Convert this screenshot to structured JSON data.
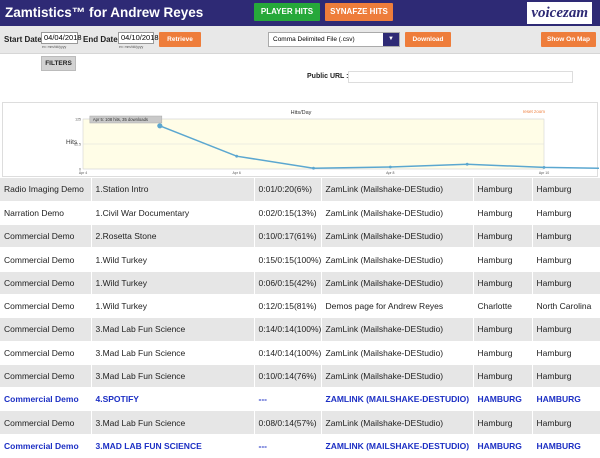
{
  "header": {
    "title": "Zamtistics™ for Andrew Reyes",
    "player_hits_label": "PLAYER HITS",
    "synafze_hits_label": "SYNAFZE HITS",
    "logo_text": "voicezam",
    "bg_color": "#2e2a75"
  },
  "controls": {
    "start_label": "Start Date:",
    "start_value": "04/04/2018",
    "start_format": "ex: mm/dd/yyyy",
    "end_label": "End Date:",
    "end_value": "04/10/2018",
    "end_format": "ex: mm/dd/yyyy",
    "retrieve_label": "Retrieve",
    "format_selected": "Comma Delimited File (.csv)",
    "download_label": "Download",
    "show_on_map_label": "Show On Map",
    "filters_label": "FILTERS",
    "public_url_label": "Public URL :",
    "public_url_value": ""
  },
  "chart_data": {
    "type": "line",
    "title": "Hits/Day",
    "ylabel": "Hits",
    "reset_label": "reset zoom",
    "tooltip": "Apr 5: 108 hits, 35 downloads",
    "x": [
      "Apr 5",
      "Apr 6",
      "Apr 7",
      "Apr 8",
      "Apr 9",
      "Apr 10",
      "Apr 11"
    ],
    "y": [
      108,
      32,
      2,
      5,
      12,
      4,
      1
    ],
    "ylim": [
      0,
      125
    ],
    "yticks": [
      "125",
      "62.5",
      "0"
    ],
    "xtick_labels": [
      {
        "label": "Apr 4",
        "x": 0
      },
      {
        "label": "Apr 6",
        "x": 2
      },
      {
        "label": "Apr 8",
        "x": 4
      },
      {
        "label": "Apr 10",
        "x": 6
      }
    ],
    "line_color": "#5ba7d0",
    "plot_bg": "#fffde7"
  },
  "table": {
    "rows": [
      {
        "type": "Radio Imaging Demo",
        "track": "1.Station Intro",
        "time": "0:01/0:20(6%)",
        "source": "ZamLink (Mailshake-DEStudio)",
        "city": "Hamburg",
        "region": "Hamburg",
        "style": "normal"
      },
      {
        "type": "Narration Demo",
        "track": "1.Civil War Documentary",
        "time": "0:02/0:15(13%)",
        "source": "ZamLink (Mailshake-DEStudio)",
        "city": "Hamburg",
        "region": "Hamburg",
        "style": "normal"
      },
      {
        "type": "Commercial Demo",
        "track": "2.Rosetta Stone",
        "time": "0:10/0:17(61%)",
        "source": "ZamLink (Mailshake-DEStudio)",
        "city": "Hamburg",
        "region": "Hamburg",
        "style": "normal"
      },
      {
        "type": "Commercial Demo",
        "track": "1.Wild Turkey",
        "time": "0:15/0:15(100%)",
        "source": "ZamLink (Mailshake-DEStudio)",
        "city": "Hamburg",
        "region": "Hamburg",
        "style": "normal"
      },
      {
        "type": "Commercial Demo",
        "track": "1.Wild Turkey",
        "time": "0:06/0:15(42%)",
        "source": "ZamLink (Mailshake-DEStudio)",
        "city": "Hamburg",
        "region": "Hamburg",
        "style": "normal"
      },
      {
        "type": "Commercial Demo",
        "track": "1.Wild Turkey",
        "time": "0:12/0:15(81%)",
        "source": "Demos page for Andrew Reyes",
        "city": "Charlotte",
        "region": "North Carolina",
        "style": "normal"
      },
      {
        "type": "Commercial Demo",
        "track": "3.Mad Lab Fun Science",
        "time": "0:14/0:14(100%)",
        "source": "ZamLink (Mailshake-DEStudio)",
        "city": "Hamburg",
        "region": "Hamburg",
        "style": "normal"
      },
      {
        "type": "Commercial Demo",
        "track": "3.Mad Lab Fun Science",
        "time": "0:14/0:14(100%)",
        "source": "ZamLink (Mailshake-DEStudio)",
        "city": "Hamburg",
        "region": "Hamburg",
        "style": "normal"
      },
      {
        "type": "Commercial Demo",
        "track": "3.Mad Lab Fun Science",
        "time": "0:10/0:14(76%)",
        "source": "ZamLink (Mailshake-DEStudio)",
        "city": "Hamburg",
        "region": "Hamburg",
        "style": "normal"
      },
      {
        "type": "Commercial Demo",
        "track": "4.Spotify",
        "time": "---",
        "source": "ZamLink (Mailshake-DEStudio)",
        "city": "Hamburg",
        "region": "Hamburg",
        "style": "blue"
      },
      {
        "type": "Commercial Demo",
        "track": "3.Mad Lab Fun Science",
        "time": "0:08/0:14(57%)",
        "source": "ZamLink (Mailshake-DEStudio)",
        "city": "Hamburg",
        "region": "Hamburg",
        "style": "normal"
      },
      {
        "type": "Commercial Demo",
        "track": "3.Mad Lab Fun Science",
        "time": "---",
        "source": "ZamLink (Mailshake-DEStudio)",
        "city": "Hamburg",
        "region": "Hamburg",
        "style": "blue"
      }
    ]
  }
}
